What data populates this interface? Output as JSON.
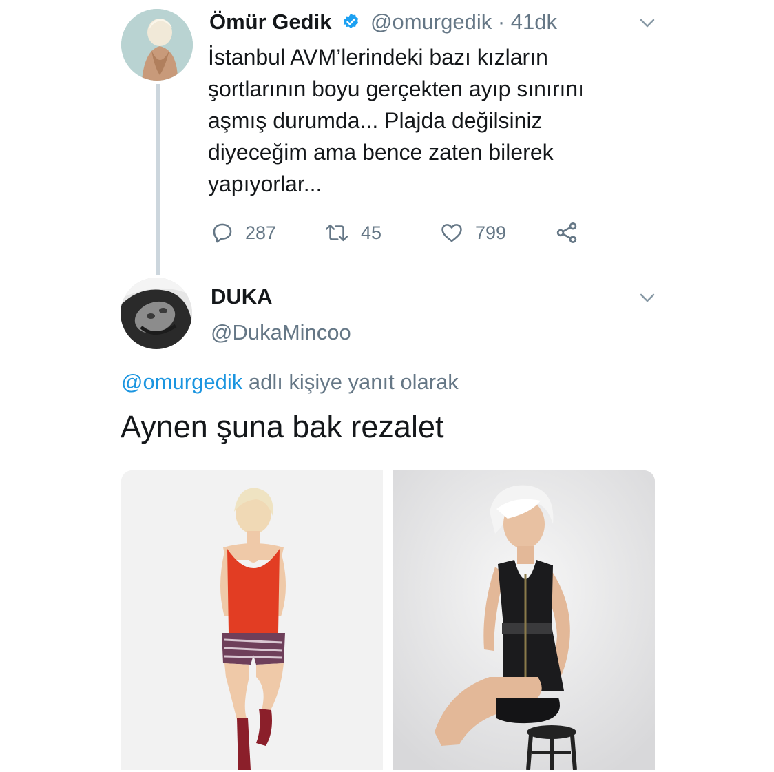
{
  "tweet": {
    "author_name": "Ömür Gedik",
    "author_handle": "@omurgedik",
    "time": "· 41dk",
    "text": "İstanbul AVM’lerindeki bazı kızların\nşortlarının boyu gerçekten ayıp sınırını\naşmış durumda... Plajda değilsiniz\ndiyeceğim ama bence zaten bilerek\nyapıyorlar...",
    "replies": "287",
    "retweets": "45",
    "likes": "799",
    "icons": {
      "verified": "verified-badge-icon",
      "reply": "reply-icon",
      "retweet": "retweet-icon",
      "like": "heart-icon",
      "share": "share-icon",
      "more": "chevron-down-icon"
    }
  },
  "reply": {
    "author_name": "DUKA",
    "author_handle": "@DukaMincoo",
    "replying_mention": "@omurgedik",
    "replying_suffix": " adlı kişiye yanıt olarak",
    "text": "Aynen şuna bak rezalet"
  },
  "colors": {
    "verified": "#1da1f2",
    "secondary_text": "#657786",
    "mention": "#1b95e0",
    "thread_line": "#ccd6dd"
  }
}
